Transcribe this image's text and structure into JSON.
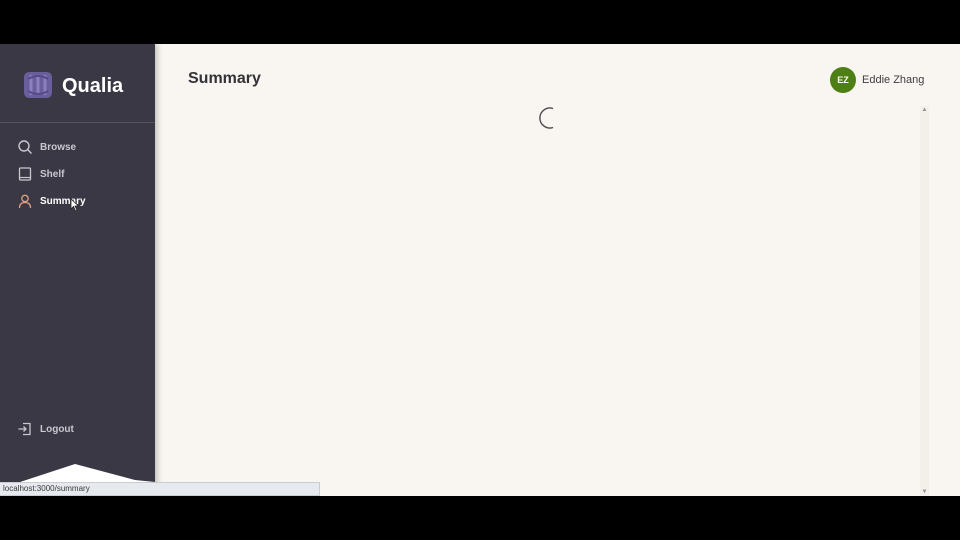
{
  "brand": {
    "name": "Qualia",
    "logo_icon": "qualia-logo-icon"
  },
  "sidebar": {
    "items": [
      {
        "label": "Browse",
        "icon": "search-icon"
      },
      {
        "label": "Shelf",
        "icon": "book-icon"
      },
      {
        "label": "Summary",
        "icon": "user-icon",
        "active": true
      }
    ],
    "logout": {
      "label": "Logout",
      "icon": "logout-icon"
    }
  },
  "header": {
    "title": "Summary"
  },
  "user": {
    "initials": "EZ",
    "name": "Eddie Zhang",
    "avatar_color": "#4e7f16"
  },
  "status_bar": {
    "url": "localhost:3000/summary"
  },
  "colors": {
    "sidebar": "#3a3844",
    "background": "#f9f6f1",
    "accent": "#7a6ba8"
  }
}
